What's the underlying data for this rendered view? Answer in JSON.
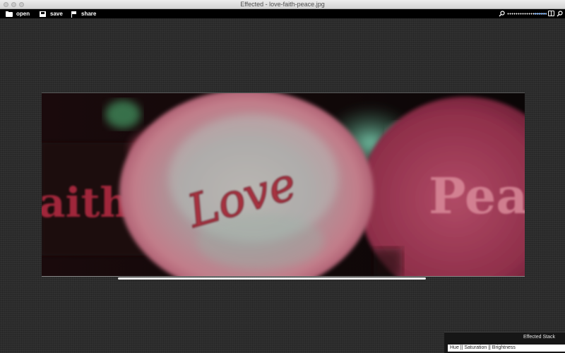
{
  "window": {
    "title": "Effected - love-faith-peace.jpg"
  },
  "toolbar": {
    "open_label": "open",
    "save_label": "save",
    "share_label": "share",
    "zoom_level": 0.7
  },
  "photo": {
    "word_love": "Love",
    "word_left": "aith",
    "word_right": "Pea"
  },
  "panel": {
    "title": "Effected Stack",
    "items": [
      "Hue || Saturation || Brightness"
    ]
  },
  "colors": {
    "toolbar_bg": "#000000",
    "canvas_bg": "#2c2c2c",
    "zoom_accent": "#5aa0ff"
  }
}
